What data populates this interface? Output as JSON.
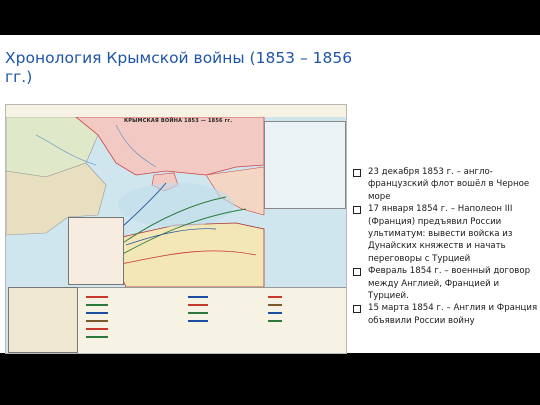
{
  "slide": {
    "title": "Хронология Крымской войны (1853 – 1856 гг.)"
  },
  "map": {
    "title": "КРЫМСКАЯ ВОЙНА 1853 — 1856 гг."
  },
  "events": [
    {
      "text": "23 декабря 1853 г. – англо-французский флот вошёл в Черное море"
    },
    {
      "text": "17 января 1854 г. – Наполеон III (Франция) предъявил России ультиматум: вывести войска из Дунайских княжеств и начать переговоры с Турцией"
    },
    {
      "text": "Февраль 1854 г. – военный договор между Англией, Францией и Турцией."
    },
    {
      "text": "15 марта 1854 г. – Англия и Франция объявили России войну"
    }
  ],
  "colors": {
    "title": "#1f55a7",
    "sea": "#cfe6ef",
    "russia": "#f3c9c4",
    "turkey": "#f4e7b7",
    "austria": "#dfe8c8"
  }
}
